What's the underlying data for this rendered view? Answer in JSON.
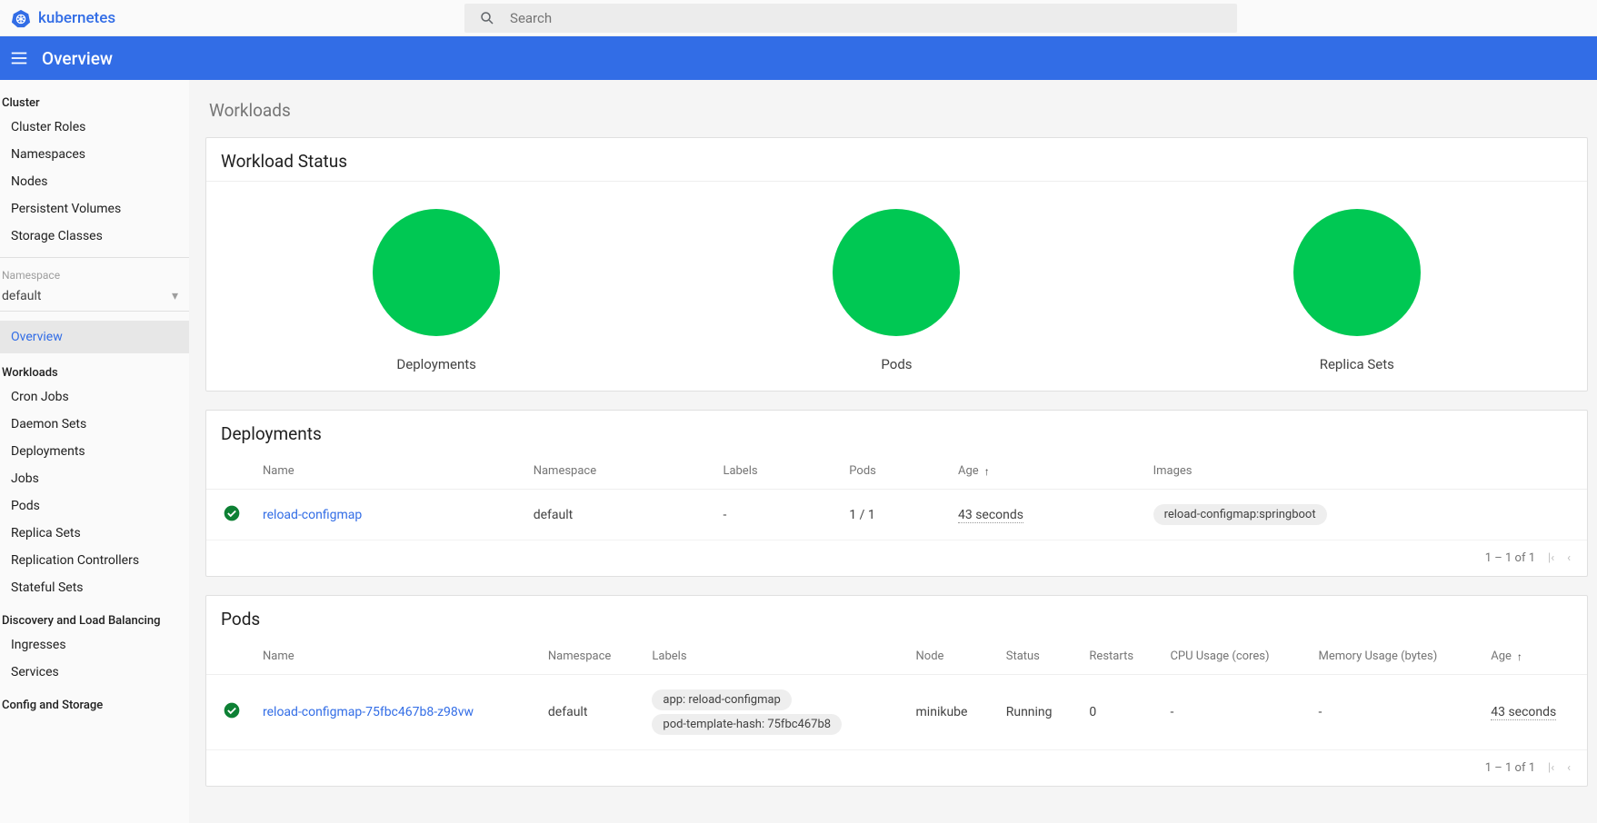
{
  "header": {
    "logo": "kubernetes",
    "search_placeholder": "Search",
    "overview": "Overview"
  },
  "sidebar": {
    "cluster_heading": "Cluster",
    "cluster_items": [
      "Cluster Roles",
      "Namespaces",
      "Nodes",
      "Persistent Volumes",
      "Storage Classes"
    ],
    "ns_label": "Namespace",
    "ns_value": "default",
    "overview": "Overview",
    "workloads_heading": "Workloads",
    "workloads_items": [
      "Cron Jobs",
      "Daemon Sets",
      "Deployments",
      "Jobs",
      "Pods",
      "Replica Sets",
      "Replication Controllers",
      "Stateful Sets"
    ],
    "dlb_heading": "Discovery and Load Balancing",
    "dlb_items": [
      "Ingresses",
      "Services"
    ],
    "cs_heading": "Config and Storage"
  },
  "page": {
    "title": "Workloads"
  },
  "status_card": {
    "title": "Workload Status",
    "items": [
      "Deployments",
      "Pods",
      "Replica Sets"
    ]
  },
  "deployments": {
    "title": "Deployments",
    "cols": [
      "Name",
      "Namespace",
      "Labels",
      "Pods",
      "Age",
      "Images"
    ],
    "row": {
      "name": "reload-configmap",
      "namespace": "default",
      "labels": "-",
      "pods": "1 / 1",
      "age": "43 seconds",
      "image": "reload-configmap:springboot"
    },
    "pager": "1 – 1 of 1"
  },
  "pods": {
    "title": "Pods",
    "cols": [
      "Name",
      "Namespace",
      "Labels",
      "Node",
      "Status",
      "Restarts",
      "CPU Usage (cores)",
      "Memory Usage (bytes)",
      "Age"
    ],
    "row": {
      "name": "reload-configmap-75fbc467b8-z98vw",
      "namespace": "default",
      "labels": [
        "app: reload-configmap",
        "pod-template-hash: 75fbc467b8"
      ],
      "node": "minikube",
      "status": "Running",
      "restarts": "0",
      "cpu": "-",
      "mem": "-",
      "age": "43 seconds"
    },
    "pager": "1 – 1 of 1"
  }
}
